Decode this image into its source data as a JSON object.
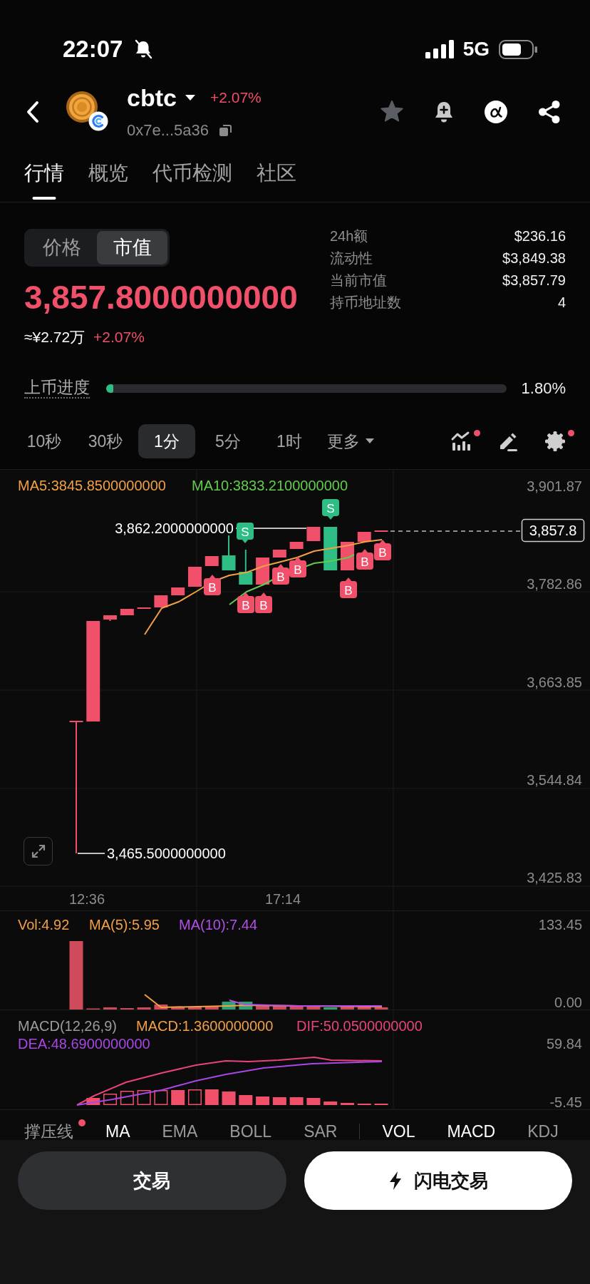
{
  "status_bar": {
    "time": "22:07",
    "network": "5G"
  },
  "header": {
    "symbol": "cbtc",
    "change": "+2.07%",
    "address": "0x7e...5a36",
    "favorite": false
  },
  "tabs": [
    {
      "label": "行情",
      "selected": true
    },
    {
      "label": "概览",
      "selected": false
    },
    {
      "label": "代币检测",
      "selected": false
    },
    {
      "label": "社区",
      "selected": false
    }
  ],
  "value_toggle": [
    {
      "label": "价格",
      "selected": false
    },
    {
      "label": "市值",
      "selected": true
    }
  ],
  "market_cap": {
    "value": "3,857.8000000000",
    "approx": "≈¥2.72万",
    "change": "+2.07%"
  },
  "stats": [
    {
      "label": "24h额",
      "value": "$236.16"
    },
    {
      "label": "流动性",
      "value": "$3,849.38"
    },
    {
      "label": "当前市值",
      "value": "$3,857.79"
    },
    {
      "label": "持币地址数",
      "value": "4"
    }
  ],
  "listing_progress": {
    "label": "上币进度",
    "level": 0.018,
    "reading": "1.80%"
  },
  "intervals": [
    {
      "label": "10秒",
      "kind": "interval",
      "selected": false
    },
    {
      "label": "30秒",
      "kind": "interval",
      "selected": false
    },
    {
      "label": "1分",
      "kind": "interval",
      "selected": true
    },
    {
      "label": "5分",
      "kind": "interval",
      "selected": false
    },
    {
      "label": "1时",
      "kind": "interval",
      "selected": false
    },
    {
      "label": "更多",
      "kind": "menu",
      "selected": false
    }
  ],
  "chart_tools": [
    {
      "kind": "indicators",
      "badge": true
    },
    {
      "kind": "draw",
      "badge": false
    },
    {
      "kind": "settings",
      "badge": true
    }
  ],
  "chart": {
    "legend": [
      {
        "text": "MA5:3845.8500000000",
        "color": "#f2a046"
      },
      {
        "text": "MA10:3833.2100000000",
        "color": "#62cc4c"
      }
    ],
    "price_axis": [
      "3,901.87",
      "3,782.86",
      "3,663.85",
      "3,544.84",
      "3,425.83"
    ],
    "time_axis": [
      "12:36",
      "17:14"
    ],
    "high_label": "3,862.2000000000",
    "low_label": "3,465.5000000000",
    "last_price": "3,857.8",
    "markers": [
      {
        "kind": "buy",
        "label": "B"
      },
      {
        "kind": "sell",
        "label": "S"
      },
      {
        "kind": "buy",
        "label": "B"
      },
      {
        "kind": "buy",
        "label": "B"
      },
      {
        "kind": "buy",
        "label": "B"
      },
      {
        "kind": "buy",
        "label": "B"
      },
      {
        "kind": "sell",
        "label": "S"
      },
      {
        "kind": "buy",
        "label": "B"
      },
      {
        "kind": "buy",
        "label": "B"
      },
      {
        "kind": "buy",
        "label": "B"
      }
    ]
  },
  "volume": {
    "legend": [
      {
        "text": "Vol:4.92",
        "color": "#f2a046"
      },
      {
        "text": "MA(5):5.95",
        "color": "#f2a046"
      },
      {
        "text": "MA(10):7.44",
        "color": "#b34fe6"
      }
    ],
    "axis": [
      "133.45",
      "0.00"
    ]
  },
  "macd": {
    "legend": [
      {
        "text": "MACD(12,26,9)",
        "color": "#9c9c9c"
      },
      {
        "text": "MACD:1.3600000000",
        "color": "#f2a046"
      },
      {
        "text": "DIF:50.0500000000",
        "color": "#e8437c"
      },
      {
        "text": "DEA:48.6900000000",
        "color": "#a946e4"
      }
    ],
    "axis": [
      "59.84",
      "-5.45"
    ]
  },
  "main_indicators": [
    {
      "label": "撑压线",
      "selected": false,
      "badge": true
    },
    {
      "label": "MA",
      "selected": true,
      "badge": false
    },
    {
      "label": "EMA",
      "selected": false,
      "badge": false
    },
    {
      "label": "BOLL",
      "selected": false,
      "badge": false
    },
    {
      "label": "SAR",
      "selected": false,
      "badge": false
    }
  ],
  "sub_indicators": [
    {
      "label": "VOL",
      "selected": true
    },
    {
      "label": "MACD",
      "selected": true
    },
    {
      "label": "KDJ",
      "selected": false
    }
  ],
  "actions": [
    {
      "label": "交易",
      "kind": "secondary"
    },
    {
      "label": "闪电交易",
      "kind": "primary"
    }
  ]
}
